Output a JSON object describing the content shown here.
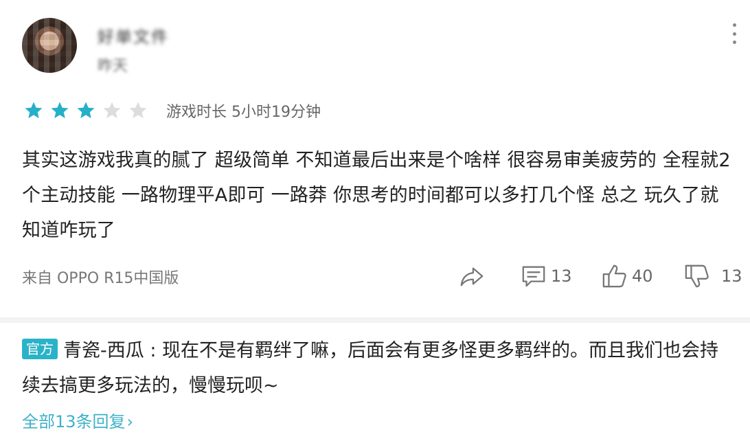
{
  "user": {
    "name": "好单文件",
    "subtitle": "昨天"
  },
  "icons": {
    "menu": "more-vertical-icon",
    "share": "share-icon",
    "comment": "comment-icon",
    "like": "thumbs-up-icon",
    "dislike": "thumbs-down-icon"
  },
  "rating": {
    "stars": 3,
    "max": 5,
    "filled_color": "#26afc9",
    "empty_color": "#dddddd",
    "playtime": "游戏时长 5小时19分钟"
  },
  "review": {
    "text": "其实这游戏我真的腻了 超级简单 不知道最后出来是个啥样 很容易审美疲劳的 全程就2个主动技能 一路物理平A即可 一路莽 你思考的时间都可以多打几个怪 总之 玩久了就知道咋玩了",
    "device": "来自 OPPO R15中国版"
  },
  "actions": {
    "comment_count": "13",
    "like_count": "40",
    "dislike_count": "13"
  },
  "reply": {
    "badge": "官方",
    "author": "青瓷-西瓜",
    "text": "现在不是有羁绊了嘛，后面会有更多怪更多羁绊的。而且我们也会持续去搞更多玩法的，慢慢玩呗~",
    "all_replies": "全部13条回复",
    "all_replies_arrow": "›"
  }
}
